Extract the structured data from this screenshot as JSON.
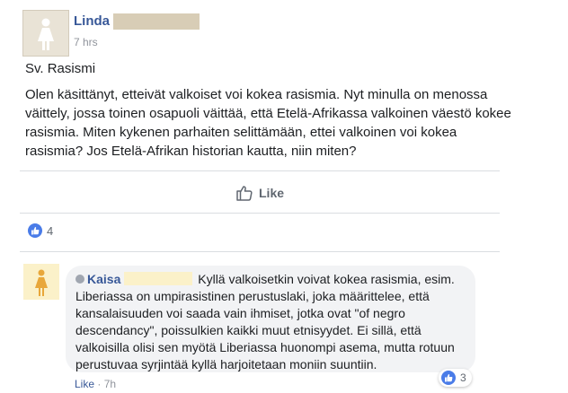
{
  "post": {
    "author": "Linda",
    "time": "7 hrs",
    "heading": "Sv. Rasismi",
    "body": "Olen käsittänyt, etteivät valkoiset voi kokea rasismia. Nyt minulla on menossa väittely, jossa toinen osapuoli väittää, että Etelä-Afrikassa valkoinen väestö kokee rasismia. Miten kykenen parhaiten selittämään, ettei valkoinen voi kokea rasismia? Jos Etelä-Afrikan historian kautta, niin miten?",
    "like_label": "Like",
    "reaction_count": "4"
  },
  "comment": {
    "author": "Kaisa",
    "text": "Kyllä valkoisetkin voivat kokea rasismia, esim. Liberiassa on umpirasistinen perustuslaki, joka määrittelee, että kansalaisuuden voi saada vain ihmiset, jotka ovat \"of negro descendancy\", poissulkien kaikki muut etnisyydet. Ei sillä, että valkoisilla olisi sen myötä Liberiassa huonompi asema, mutta rotuun perustuvaa syrjintää kyllä harjoitetaan moniin suuntiin.",
    "reaction_count": "3",
    "like_label": "Like",
    "separator": " · ",
    "time": "7h"
  },
  "colors": {
    "name_link": "#385898",
    "like_reaction": "#4a7ce8",
    "avatar_male_female_bg": "#e9e3d6",
    "comment_avatar_bg": "#fbf1c9"
  },
  "icons": {
    "post_avatar": "female-figure-icon",
    "comment_avatar": "female-figure-icon",
    "like_button": "thumbs-up-outline-icon",
    "reaction": "like-reaction-icon",
    "verified": "verified-icon"
  }
}
